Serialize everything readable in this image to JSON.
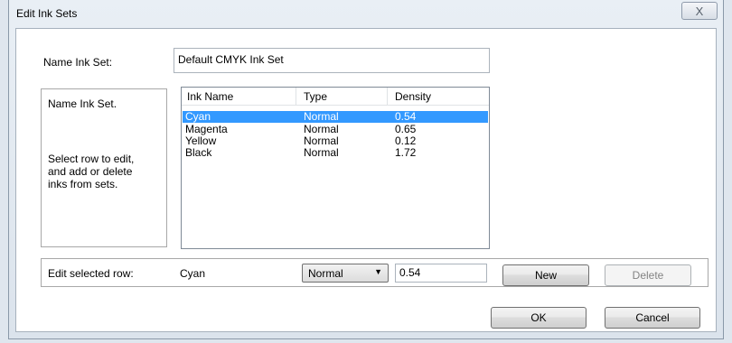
{
  "window": {
    "title": "Edit Ink Sets",
    "close_glyph": "X"
  },
  "name_ink_set": {
    "label": "Name Ink Set:",
    "value": "Default CMYK Ink Set"
  },
  "help": {
    "title": "Name Ink Set.",
    "text_lines": [
      "Select row to edit,",
      "and add or delete",
      "inks from sets."
    ]
  },
  "table": {
    "headers": [
      "Ink Name",
      "Type",
      "Density"
    ],
    "rows": [
      {
        "name": "Cyan",
        "type": "Normal",
        "density": "0.54",
        "selected": true
      },
      {
        "name": "Magenta",
        "type": "Normal",
        "density": "0.65",
        "selected": false
      },
      {
        "name": "Yellow",
        "type": "Normal",
        "density": "0.12",
        "selected": false
      },
      {
        "name": "Black",
        "type": "Normal",
        "density": "1.72",
        "selected": false
      }
    ]
  },
  "edit_row": {
    "label": "Edit selected row:",
    "ink_name": "Cyan",
    "type_value": "Normal",
    "density_value": "0.54",
    "new_label": "New",
    "delete_label": "Delete"
  },
  "footer": {
    "ok_label": "OK",
    "cancel_label": "Cancel"
  },
  "colors": {
    "selection": "#3399ff",
    "window_bg": "#dfe6ee"
  }
}
